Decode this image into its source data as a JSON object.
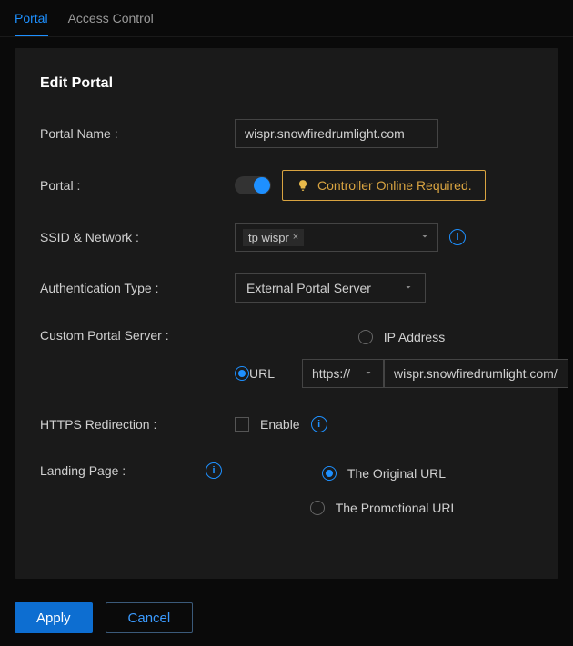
{
  "tabs": {
    "portal": "Portal",
    "access_control": "Access Control"
  },
  "header": {
    "title": "Edit Portal"
  },
  "form": {
    "portal_name": {
      "label": "Portal Name :",
      "value": "wispr.snowfiredrumlight.com"
    },
    "portal_toggle": {
      "label": "Portal :",
      "notice": "Controller Online Required."
    },
    "ssid": {
      "label": "SSID & Network :",
      "tag": "tp wispr"
    },
    "auth_type": {
      "label": "Authentication Type :",
      "value": "External Portal Server"
    },
    "custom_server": {
      "label": "Custom Portal Server :",
      "opt_ip": "IP Address",
      "opt_url": "URL",
      "scheme": "https://",
      "url_value": "wispr.snowfiredrumlight.com/p"
    },
    "https_redirect": {
      "label": "HTTPS Redirection :",
      "enable": "Enable"
    },
    "landing": {
      "label": "Landing Page :",
      "opt_original": "The Original URL",
      "opt_promo": "The Promotional URL"
    }
  },
  "footer": {
    "apply": "Apply",
    "cancel": "Cancel"
  }
}
